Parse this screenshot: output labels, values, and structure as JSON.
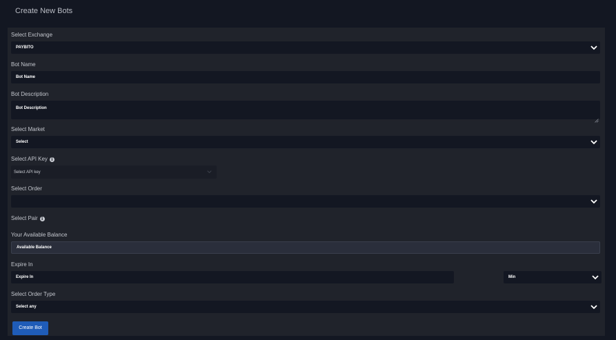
{
  "header": {
    "title": "Create New Bots"
  },
  "form": {
    "exchange": {
      "label": "Select Exchange",
      "value": "PAYBITO"
    },
    "bot_name": {
      "label": "Bot Name",
      "placeholder": "Bot Name"
    },
    "bot_description": {
      "label": "Bot Description",
      "placeholder": "Bot Description"
    },
    "market": {
      "label": "Select Market",
      "value": "Select"
    },
    "api_key": {
      "label": "Select API Key",
      "value": "Select API key"
    },
    "order": {
      "label": "Select Order",
      "value": ""
    },
    "pair": {
      "label": "Select Pair"
    },
    "balance": {
      "label": "Your Available Balance",
      "value": "Available Balance"
    },
    "expire": {
      "label": "Expire In",
      "placeholder": "Expire In",
      "unit": "Min"
    },
    "order_type": {
      "label": "Select Order Type",
      "value": "Select any"
    },
    "submit_label": "Create Bot"
  },
  "icons": {
    "info": "info-icon",
    "dropdown": "chevron-down-icon",
    "resize": "resize-handle-icon"
  },
  "colors": {
    "background": "#131722",
    "panel": "#20232b",
    "field": "#131722",
    "button": "#1f5cb8"
  }
}
